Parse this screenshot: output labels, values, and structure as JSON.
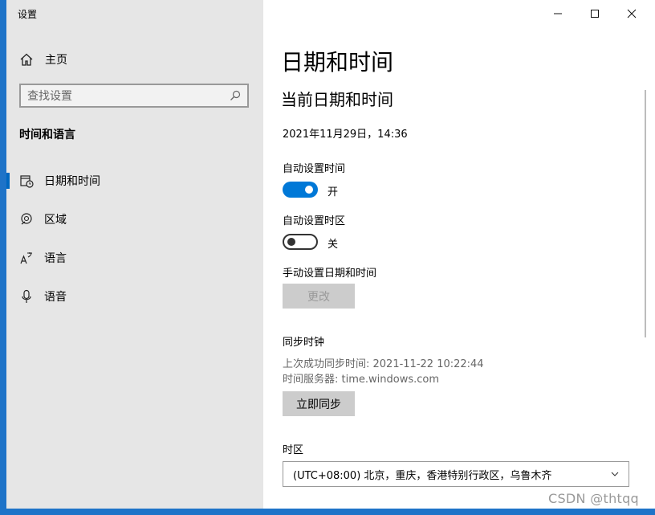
{
  "window": {
    "title": "设置"
  },
  "sidebar": {
    "home_label": "主页",
    "search_placeholder": "查找设置",
    "section_title": "时间和语言",
    "items": [
      {
        "label": "日期和时间",
        "icon": "calendar-clock-icon",
        "selected": true
      },
      {
        "label": "区域",
        "icon": "globe-icon",
        "selected": false
      },
      {
        "label": "语言",
        "icon": "language-icon",
        "selected": false
      },
      {
        "label": "语音",
        "icon": "microphone-icon",
        "selected": false
      }
    ]
  },
  "main": {
    "page_title": "日期和时间",
    "section_title": "当前日期和时间",
    "current_datetime": "2021年11月29日，14:36",
    "auto_time": {
      "label": "自动设置时间",
      "state_text": "开",
      "on": true
    },
    "auto_timezone": {
      "label": "自动设置时区",
      "state_text": "关",
      "on": false
    },
    "manual": {
      "label": "手动设置日期和时间",
      "button": "更改"
    },
    "sync": {
      "label": "同步时钟",
      "last_sync": "上次成功同步时间: 2021-11-22 10:22:44",
      "server": "时间服务器: time.windows.com",
      "button": "立即同步"
    },
    "timezone": {
      "label": "时区",
      "value": "(UTC+08:00) 北京，重庆，香港特别行政区，乌鲁木齐"
    }
  },
  "watermark": "CSDN @thtqq",
  "colors": {
    "accent": "#0078d7",
    "sidebar_bg": "#e6e6e6",
    "desktop": "#1e73c8"
  }
}
